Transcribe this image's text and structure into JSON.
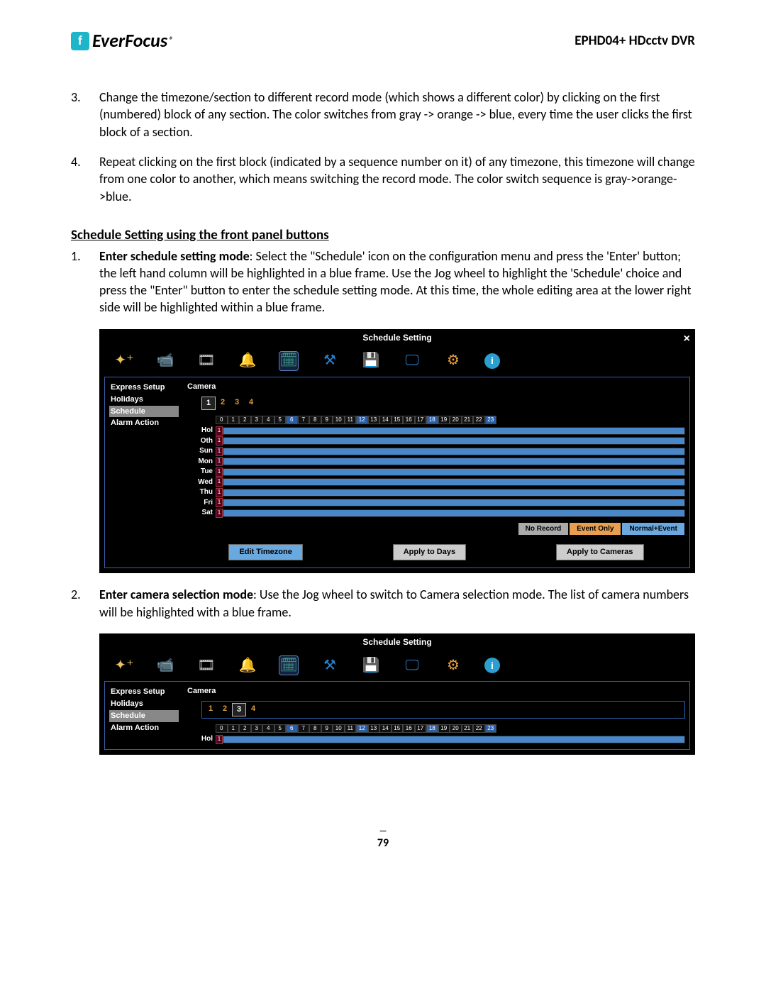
{
  "header": {
    "brand": "EverFocus",
    "reg": "®",
    "doc_title": "EPHD04+  HDcctv DVR"
  },
  "list_a": [
    {
      "num": "3.",
      "text": "Change the timezone/section to different record mode (which shows a different color) by clicking on the first (numbered) block of any section. The color switches from gray -> orange -> blue, every time the user clicks the first block of a section."
    },
    {
      "num": "4.",
      "text": "Repeat clicking on the first block (indicated by a sequence number on it) of any timezone, this timezone will change from one color to another, which means switching the record mode. The color switch sequence is gray->orange->blue."
    }
  ],
  "section_heading": "Schedule Setting using the front panel buttons",
  "list_b": [
    {
      "num": "1.",
      "bold": "Enter schedule setting mode",
      "text": ": Select the \"Schedule' icon on the configuration menu and press the 'Enter' button; the left hand column will be highlighted in a blue frame. Use the Jog wheel to highlight the 'Schedule' choice and press the \"Enter\" button to enter the schedule setting mode. At this time, the whole editing area at the lower right side will be highlighted within a blue frame."
    },
    {
      "num": "2.",
      "bold": "Enter camera selection mode",
      "text": ": Use the Jog wheel to switch to Camera selection mode. The list of camera numbers will be highlighted with a blue frame."
    }
  ],
  "ss": {
    "title": "Schedule Setting",
    "close": "×",
    "sidebar": [
      "Express Setup",
      "Holidays",
      "Schedule",
      "Alarm Action"
    ],
    "camera_label": "Camera",
    "cameras": [
      "1",
      "2",
      "3",
      "4"
    ],
    "hours": [
      "0",
      "1",
      "2",
      "3",
      "4",
      "5",
      "6",
      "7",
      "8",
      "9",
      "10",
      "11",
      "12",
      "13",
      "14",
      "15",
      "16",
      "17",
      "18",
      "19",
      "20",
      "21",
      "22",
      "23"
    ],
    "hl_hours_1": [
      6,
      12,
      18,
      23
    ],
    "days": [
      "Hol",
      "Oth",
      "Sun",
      "Mon",
      "Tue",
      "Wed",
      "Thu",
      "Fri",
      "Sat"
    ],
    "legend": {
      "no_record": "No Record",
      "event_only": "Event Only",
      "normal_event": "Normal+Event"
    },
    "buttons": {
      "edit": "Edit Timezone",
      "days": "Apply to Days",
      "cams": "Apply to Cameras"
    },
    "selected_cam_1": "1",
    "selected_cam_2": "3",
    "days_2": [
      "Hol"
    ]
  },
  "page_num": "79"
}
